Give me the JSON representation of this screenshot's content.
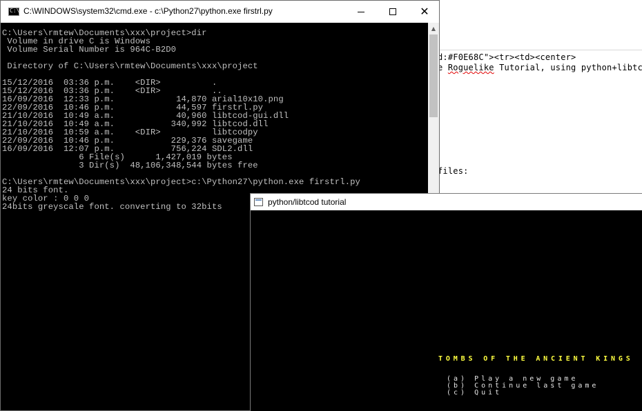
{
  "background_editor": {
    "line1": "d:#F0E68C\"><tr><td><center>",
    "line2_prefix": "e ",
    "line2_squiggle": "Roguelike",
    "line2_rest": " Tutorial, using python+libtco",
    "line3": "files:"
  },
  "cmd_window": {
    "title": "C:\\WINDOWS\\system32\\cmd.exe - c:\\Python27\\python.exe  firstrl.py",
    "lines": [
      "C:\\Users\\rmtew\\Documents\\xxx\\project>dir",
      " Volume in drive C is Windows",
      " Volume Serial Number is 964C-B2D0",
      "",
      " Directory of C:\\Users\\rmtew\\Documents\\xxx\\project",
      "",
      "15/12/2016  03:36 p.m.    <DIR>          .",
      "15/12/2016  03:36 p.m.    <DIR>          ..",
      "16/09/2016  12:33 p.m.            14,870 arial10x10.png",
      "22/09/2016  10:46 p.m.            44,597 firstrl.py",
      "21/10/2016  10:49 a.m.            40,960 libtcod-gui.dll",
      "21/10/2016  10:49 a.m.           340,992 libtcod.dll",
      "21/10/2016  10:59 a.m.    <DIR>          libtcodpy",
      "22/09/2016  10:46 p.m.           229,376 savegame",
      "16/09/2016  12:07 p.m.           756,224 SDL2.dll",
      "               6 File(s)      1,427,019 bytes",
      "               3 Dir(s)  48,106,348,544 bytes free",
      "",
      "C:\\Users\\rmtew\\Documents\\xxx\\project>c:\\Python27\\python.exe firstrl.py",
      "24 bits font.",
      "key color : 0 0 0",
      "24bits greyscale font. converting to 32bits"
    ]
  },
  "tcod_window": {
    "title": "python/libtcod tutorial",
    "game_title": "TOMBS OF THE ANCIENT KINGS",
    "menu": [
      "(a) Play a new game",
      "(b) Continue last game",
      "(c) Quit"
    ]
  }
}
